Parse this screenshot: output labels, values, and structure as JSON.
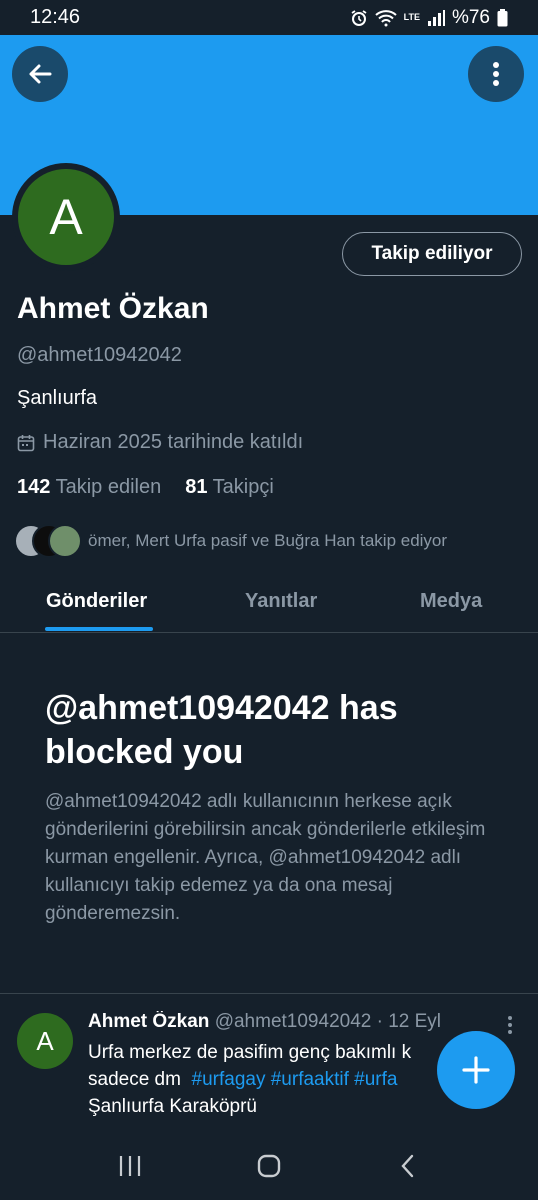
{
  "status_bar": {
    "time": "12:46",
    "battery": "%76",
    "network": "LTE"
  },
  "profile": {
    "avatar_letter": "A",
    "follow_button": "Takip ediliyor",
    "display_name": "Ahmet Özkan",
    "handle": "@ahmet10942042",
    "location": "Şanlıurfa",
    "joined": "Haziran 2025 tarihinde katıldı",
    "following_count": "142",
    "following_label": "Takip edilen",
    "followers_count": "81",
    "followers_label": "Takipçi",
    "known_followers": "ömer, Mert Urfa pasif ve Buğra Han takip ediyor"
  },
  "tabs": [
    {
      "label": "Gönderiler",
      "selected": true
    },
    {
      "label": "Yanıtlar",
      "selected": false
    },
    {
      "label": "Medya",
      "selected": false
    }
  ],
  "blocked": {
    "title": "@ahmet10942042 has blocked you",
    "description": "@ahmet10942042 adlı kullanıcının herkese açık gönderilerini görebilirsin ancak gönderilerle etkileşim kurman engellenir. Ayrıca, @ahmet10942042 adlı kullanıcıyı takip edemez ya da ona mesaj gönderemezsin."
  },
  "tweet": {
    "avatar_letter": "A",
    "name": "Ahmet Özkan",
    "meta": "@ahmet10942042 · 12 Eyl",
    "line1": "Urfa merkez de pasifim genç bakımlı k",
    "line2_text": "sadece dm",
    "hashtags": "#urfagay #urfaaktif #urfa",
    "line3": "Şanlıurfa Karaköprü"
  },
  "colors": {
    "background": "#15202b",
    "accent": "#1d9bf0",
    "secondary_text": "#8b98a5",
    "avatar": "#2e6b1f"
  },
  "icons": [
    "back-arrow-icon",
    "more-vertical-icon",
    "calendar-icon",
    "plus-icon",
    "recents-icon",
    "home-icon",
    "nav-back-icon"
  ]
}
